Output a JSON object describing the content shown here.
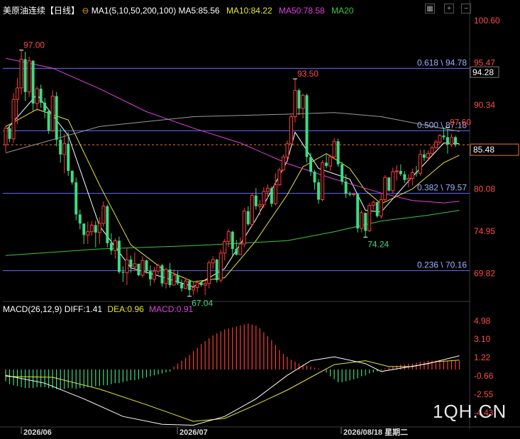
{
  "header": {
    "symbol": "美原油连续",
    "period": "【日线】",
    "settings_glyph": "⊖",
    "ma_params": "MA1(5,10,50,200,100)",
    "ma5": "MA5:85.56",
    "ma10": "MA10:84.22",
    "ma50": "MA50:78.58",
    "ma20": "MA20"
  },
  "macd_header": {
    "params": "MACD(26,12,9)",
    "diff": "DIFF:1.41",
    "dea": "DEA:0.96",
    "macd": "MACD:0.91"
  },
  "watermark": "1QH.CN",
  "colors": {
    "up": "#ff3b3b",
    "down": "#3ddc84",
    "ma5": "#ffffff",
    "ma10": "#e6e63c",
    "ma50": "#e040e0",
    "ma200": "#9a9a9a",
    "ma100": "#3cc83c",
    "fib": "#6a6aff",
    "background": "#000000"
  },
  "chart_data": {
    "type": "candlestick",
    "price_axis": {
      "ticks": [
        "100.60",
        "95.47",
        "90.34",
        "85.21",
        "80.08",
        "74.95",
        "69.82"
      ],
      "ylim": [
        66.5,
        101.2
      ]
    },
    "date_labels": [
      "2026/06",
      "2026/07",
      "2026/08/18 星期二"
    ],
    "fib_levels": [
      {
        "value": 94.78,
        "label": "0.618 \\ 94.78"
      },
      {
        "value": 87.18,
        "label": "0.500 \\ 87.18"
      },
      {
        "value": 79.57,
        "label": "0.382 \\ 79.57"
      },
      {
        "value": 70.16,
        "label": "0.236 \\ 70.16"
      }
    ],
    "current_price": {
      "value": 85.48,
      "label": "85.48"
    },
    "crosshair_price": {
      "value": 94.28,
      "label": "94.28"
    },
    "high_low_labels": [
      {
        "index": 4,
        "value": 97.0,
        "label": "97.00",
        "kind": "high"
      },
      {
        "index": 47,
        "value": 67.04,
        "label": "67.04",
        "kind": "low"
      },
      {
        "index": 74,
        "value": 93.5,
        "label": "93.50",
        "kind": "high"
      },
      {
        "index": 92,
        "value": 74.24,
        "label": "74.24",
        "kind": "low"
      },
      {
        "index": 113,
        "value": 87.6,
        "label": "87.60",
        "kind": "high"
      }
    ],
    "candles": [
      [
        85.5,
        87.8,
        84.6,
        87.5
      ],
      [
        87.5,
        88.0,
        85.8,
        86.2
      ],
      [
        86.2,
        91.8,
        85.7,
        91.0
      ],
      [
        91.0,
        93.6,
        88.0,
        92.4
      ],
      [
        92.4,
        97.0,
        91.6,
        95.9
      ],
      [
        95.9,
        96.8,
        90.8,
        91.9
      ],
      [
        91.9,
        96.2,
        91.3,
        95.7
      ],
      [
        95.7,
        95.8,
        89.6,
        90.5
      ],
      [
        90.5,
        92.6,
        89.6,
        92.3
      ],
      [
        92.3,
        92.8,
        90.0,
        90.6
      ],
      [
        90.6,
        91.2,
        88.7,
        89.6
      ],
      [
        89.6,
        89.8,
        86.8,
        87.2
      ],
      [
        87.2,
        92.1,
        87.0,
        91.4
      ],
      [
        91.4,
        91.9,
        85.3,
        86.1
      ],
      [
        86.1,
        87.5,
        83.3,
        84.3
      ],
      [
        84.3,
        86.8,
        82.0,
        85.6
      ],
      [
        85.6,
        87.0,
        81.7,
        82.3
      ],
      [
        82.3,
        82.4,
        80.6,
        80.9
      ],
      [
        80.9,
        81.5,
        76.3,
        77.0
      ],
      [
        77.0,
        77.6,
        75.2,
        75.9
      ],
      [
        75.9,
        75.9,
        73.4,
        74.5
      ],
      [
        74.5,
        76.1,
        73.4,
        74.9
      ],
      [
        74.9,
        76.2,
        74.4,
        75.7
      ],
      [
        75.7,
        76.2,
        73.0,
        74.8
      ],
      [
        74.8,
        76.7,
        73.4,
        75.9
      ],
      [
        75.9,
        78.6,
        75.5,
        78.0
      ],
      [
        78.0,
        78.2,
        73.0,
        73.5
      ],
      [
        73.5,
        74.7,
        72.1,
        72.6
      ],
      [
        72.6,
        74.1,
        71.6,
        73.8
      ],
      [
        73.8,
        74.3,
        69.8,
        70.0
      ],
      [
        70.0,
        70.7,
        68.8,
        69.9
      ],
      [
        69.9,
        72.9,
        68.4,
        71.5
      ],
      [
        71.5,
        72.0,
        69.9,
        70.6
      ],
      [
        70.6,
        72.4,
        70.2,
        71.0
      ],
      [
        71.0,
        71.0,
        69.5,
        69.6
      ],
      [
        69.6,
        71.9,
        69.3,
        71.4
      ],
      [
        71.4,
        71.5,
        69.8,
        70.1
      ],
      [
        70.1,
        70.8,
        68.3,
        69.1
      ],
      [
        69.1,
        70.6,
        68.7,
        70.1
      ],
      [
        70.1,
        71.0,
        69.7,
        70.8
      ],
      [
        70.8,
        71.0,
        68.2,
        68.6
      ],
      [
        68.6,
        70.5,
        68.0,
        70.3
      ],
      [
        70.3,
        71.1,
        68.1,
        68.4
      ],
      [
        68.4,
        70.3,
        68.4,
        69.6
      ],
      [
        69.6,
        70.1,
        68.4,
        68.6
      ],
      [
        68.6,
        69.1,
        67.6,
        68.0
      ],
      [
        68.0,
        69.3,
        67.9,
        68.9
      ],
      [
        68.9,
        69.1,
        67.0,
        67.8
      ],
      [
        67.8,
        68.8,
        67.2,
        68.1
      ],
      [
        68.1,
        69.0,
        67.5,
        68.7
      ],
      [
        68.7,
        68.8,
        68.2,
        68.4
      ],
      [
        68.4,
        68.9,
        67.2,
        68.6
      ],
      [
        68.6,
        71.4,
        68.0,
        71.1
      ],
      [
        71.1,
        71.9,
        70.4,
        71.5
      ],
      [
        71.5,
        71.6,
        68.7,
        69.0
      ],
      [
        69.0,
        72.7,
        68.7,
        72.3
      ],
      [
        72.3,
        74.0,
        71.4,
        73.7
      ],
      [
        73.7,
        75.2,
        73.0,
        74.9
      ],
      [
        74.9,
        75.0,
        72.0,
        72.8
      ],
      [
        72.8,
        73.9,
        72.0,
        72.1
      ],
      [
        72.1,
        74.2,
        72.1,
        73.4
      ],
      [
        73.4,
        77.8,
        73.0,
        77.4
      ],
      [
        77.4,
        78.0,
        75.6,
        75.8
      ],
      [
        75.8,
        79.6,
        75.6,
        79.3
      ],
      [
        79.3,
        80.2,
        77.6,
        78.0
      ],
      [
        78.0,
        78.8,
        76.9,
        78.2
      ],
      [
        78.2,
        80.3,
        77.8,
        79.8
      ],
      [
        79.8,
        80.7,
        79.0,
        80.2
      ],
      [
        80.2,
        80.4,
        77.9,
        78.3
      ],
      [
        78.3,
        82.0,
        78.1,
        80.6
      ],
      [
        80.6,
        82.7,
        80.5,
        82.4
      ],
      [
        82.4,
        84.3,
        82.3,
        84.0
      ],
      [
        84.0,
        86.0,
        83.6,
        85.6
      ],
      [
        85.6,
        89.1,
        85.5,
        88.9
      ],
      [
        88.9,
        93.5,
        88.2,
        92.1
      ],
      [
        92.1,
        92.3,
        89.1,
        89.9
      ],
      [
        89.9,
        91.7,
        88.7,
        91.5
      ],
      [
        91.5,
        91.7,
        83.3,
        84.0
      ],
      [
        84.0,
        84.5,
        81.7,
        82.2
      ],
      [
        82.2,
        82.4,
        80.0,
        80.9
      ],
      [
        80.9,
        81.3,
        78.3,
        78.8
      ],
      [
        78.8,
        83.6,
        78.6,
        83.3
      ],
      [
        83.3,
        84.3,
        82.6,
        82.9
      ],
      [
        82.9,
        84.3,
        82.3,
        84.0
      ],
      [
        84.0,
        86.3,
        83.9,
        85.9
      ],
      [
        85.9,
        86.2,
        82.8,
        83.1
      ],
      [
        83.1,
        83.4,
        80.6,
        81.0
      ],
      [
        81.0,
        81.9,
        79.0,
        79.5
      ],
      [
        79.5,
        79.8,
        79.2,
        79.4
      ],
      [
        79.4,
        79.6,
        79.2,
        79.5
      ],
      [
        79.5,
        79.5,
        74.8,
        75.3
      ],
      [
        75.3,
        77.5,
        74.8,
        77.2
      ],
      [
        77.2,
        77.2,
        74.2,
        75.0
      ],
      [
        75.0,
        78.4,
        74.9,
        78.1
      ],
      [
        78.1,
        78.7,
        77.6,
        78.5
      ],
      [
        78.5,
        78.5,
        76.6,
        76.8
      ],
      [
        76.8,
        79.6,
        76.5,
        78.8
      ],
      [
        78.8,
        81.8,
        78.6,
        81.5
      ],
      [
        81.5,
        81.5,
        79.8,
        79.9
      ],
      [
        79.9,
        82.7,
        79.6,
        82.2
      ],
      [
        82.2,
        83.0,
        81.1,
        82.3
      ],
      [
        82.3,
        83.1,
        81.7,
        81.9
      ],
      [
        81.9,
        82.3,
        80.8,
        81.2
      ],
      [
        81.2,
        81.9,
        80.3,
        81.4
      ],
      [
        81.4,
        82.6,
        80.5,
        82.1
      ],
      [
        82.1,
        82.9,
        81.6,
        82.0
      ],
      [
        82.0,
        84.9,
        81.7,
        84.3
      ],
      [
        84.3,
        84.9,
        83.5,
        83.9
      ],
      [
        83.9,
        84.8,
        83.5,
        84.4
      ],
      [
        84.4,
        85.4,
        84.3,
        85.1
      ],
      [
        85.1,
        86.1,
        85.0,
        85.8
      ],
      [
        85.8,
        86.8,
        85.5,
        86.6
      ],
      [
        86.6,
        87.6,
        86.1,
        86.4
      ],
      [
        86.4,
        87.4,
        84.4,
        85.5
      ],
      [
        85.5,
        86.8,
        85.2,
        86.4
      ],
      [
        86.4,
        86.6,
        85.2,
        85.5
      ]
    ],
    "moving_averages": [
      {
        "name": "MA5",
        "color_key": "ma5",
        "points": [
          [
            0,
            87.2
          ],
          [
            8,
            91.6
          ],
          [
            16,
            86.6
          ],
          [
            24,
            75.6
          ],
          [
            32,
            70.5
          ],
          [
            40,
            69.4
          ],
          [
            48,
            68.2
          ],
          [
            56,
            70.4
          ],
          [
            64,
            76.4
          ],
          [
            72,
            83.5
          ],
          [
            74,
            87.0
          ],
          [
            80,
            82.6
          ],
          [
            88,
            81.3
          ],
          [
            92,
            77.5
          ],
          [
            96,
            77.3
          ],
          [
            104,
            81.6
          ],
          [
            112,
            85.7
          ],
          [
            116,
            85.6
          ]
        ]
      },
      {
        "name": "MA10",
        "color_key": "ma10",
        "points": [
          [
            0,
            87.7
          ],
          [
            8,
            89.8
          ],
          [
            16,
            88.5
          ],
          [
            24,
            80.6
          ],
          [
            32,
            73.3
          ],
          [
            40,
            70.4
          ],
          [
            48,
            68.8
          ],
          [
            56,
            69.3
          ],
          [
            64,
            73.8
          ],
          [
            72,
            79.4
          ],
          [
            76,
            82.8
          ],
          [
            82,
            84.4
          ],
          [
            88,
            82.6
          ],
          [
            92,
            79.9
          ],
          [
            96,
            78.3
          ],
          [
            104,
            80.1
          ],
          [
            112,
            83.3
          ],
          [
            116,
            84.2
          ]
        ]
      },
      {
        "name": "MA50",
        "color_key": "ma50",
        "points": [
          [
            0,
            96.0
          ],
          [
            12,
            94.8
          ],
          [
            24,
            92.3
          ],
          [
            36,
            89.5
          ],
          [
            48,
            87.5
          ],
          [
            60,
            85.7
          ],
          [
            72,
            83.2
          ],
          [
            84,
            81.3
          ],
          [
            96,
            79.6
          ],
          [
            104,
            78.7
          ],
          [
            112,
            78.4
          ],
          [
            116,
            78.6
          ]
        ]
      },
      {
        "name": "MA200",
        "color_key": "ma200",
        "points": [
          [
            0,
            84.5
          ],
          [
            24,
            87.7
          ],
          [
            48,
            88.9
          ],
          [
            72,
            89.2
          ],
          [
            84,
            89.4
          ],
          [
            96,
            88.9
          ],
          [
            108,
            87.8
          ],
          [
            116,
            87.1
          ]
        ]
      },
      {
        "name": "MA100",
        "color_key": "ma100",
        "points": [
          [
            0,
            72.0
          ],
          [
            24,
            72.8
          ],
          [
            48,
            73.2
          ],
          [
            72,
            73.8
          ],
          [
            84,
            74.9
          ],
          [
            96,
            76.2
          ],
          [
            108,
            76.9
          ],
          [
            116,
            77.5
          ]
        ]
      }
    ],
    "macd": {
      "axis_ticks": [
        "4.98",
        "3.10",
        "1.22",
        "-0.66",
        "-2.55",
        "-4.43"
      ],
      "ylim": [
        -5.8,
        5.8
      ],
      "diff": [
        [
          0,
          -0.6
        ],
        [
          10,
          -1.4
        ],
        [
          20,
          -3.0
        ],
        [
          30,
          -4.8
        ],
        [
          40,
          -5.6
        ],
        [
          48,
          -5.7
        ],
        [
          56,
          -4.8
        ],
        [
          64,
          -3.0
        ],
        [
          72,
          -0.6
        ],
        [
          78,
          0.9
        ],
        [
          84,
          1.3
        ],
        [
          92,
          0.6
        ],
        [
          96,
          -0.2
        ],
        [
          102,
          0.2
        ],
        [
          108,
          0.6
        ],
        [
          116,
          1.41
        ]
      ],
      "dea": [
        [
          0,
          -0.7
        ],
        [
          12,
          -0.8
        ],
        [
          24,
          -2.0
        ],
        [
          36,
          -3.6
        ],
        [
          48,
          -5.3
        ],
        [
          56,
          -5.0
        ],
        [
          64,
          -3.6
        ],
        [
          72,
          -2.1
        ],
        [
          78,
          -0.8
        ],
        [
          84,
          0.5
        ],
        [
          92,
          0.9
        ],
        [
          98,
          0.3
        ],
        [
          104,
          0.3
        ],
        [
          110,
          0.8
        ],
        [
          116,
          0.96
        ]
      ],
      "hist": [
        -1.2,
        -1.5,
        -1.6,
        -1.7,
        -1.8,
        -1.9,
        -1.9,
        -1.9,
        -1.8,
        -1.8,
        -1.8,
        -1.9,
        -1.9,
        -2.0,
        -2.0,
        -2.0,
        -1.9,
        -1.9,
        -2.0,
        -1.9,
        -1.9,
        -1.8,
        -1.8,
        -1.7,
        -1.7,
        -1.6,
        -1.6,
        -1.5,
        -1.4,
        -1.4,
        -1.3,
        -1.2,
        -1.1,
        -1.1,
        -1.0,
        -0.9,
        -0.8,
        -0.7,
        -0.6,
        -0.5,
        -0.4,
        -0.3,
        -0.2,
        0.3,
        0.6,
        0.9,
        1.2,
        1.5,
        1.9,
        2.2,
        2.6,
        2.9,
        3.2,
        3.5,
        3.7,
        3.9,
        4.1,
        4.2,
        4.3,
        4.4,
        4.5,
        4.6,
        4.7,
        4.6,
        4.5,
        4.2,
        3.8,
        3.4,
        3.0,
        2.5,
        2.0,
        1.6,
        1.3,
        1.0,
        0.8,
        0.6,
        0.5,
        0.4,
        0.3,
        0.2,
        0.1,
        0.0,
        -0.3,
        -0.7,
        -1.0,
        -1.3,
        -1.3,
        -1.2,
        -1.1,
        -1.0,
        -0.9,
        -0.7,
        -0.6,
        -0.4,
        -0.3,
        -0.2,
        -0.1,
        0.1,
        0.2,
        0.3,
        0.4,
        0.5,
        0.5,
        0.6,
        0.6,
        0.7,
        0.8,
        0.8,
        0.9,
        0.9,
        0.9,
        0.9,
        0.9,
        0.9,
        0.9,
        0.9,
        0.91
      ]
    }
  }
}
